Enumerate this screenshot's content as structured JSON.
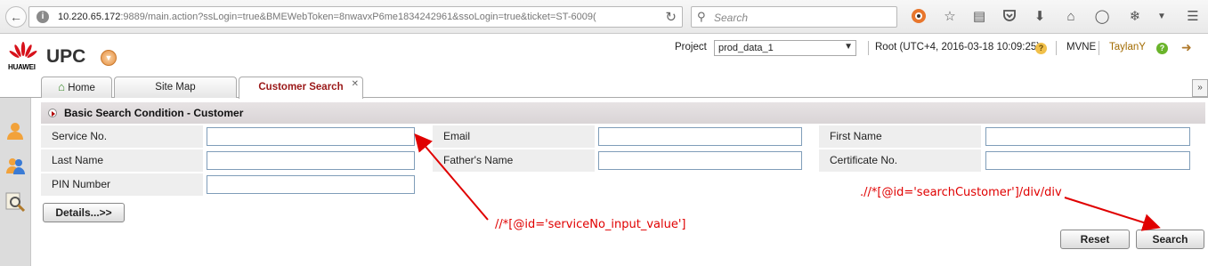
{
  "browser": {
    "url_host": "10.220.65.172",
    "url_rest": ":9889/main.action?ssLogin=true&BMEWebToken=8nwavxP6me1834242961&ssoLogin=true&ticket=ST-6009(",
    "search_placeholder": "Search",
    "icons": [
      "back-icon",
      "info-icon",
      "reload-icon",
      "search-icon",
      "extension-icon",
      "star-icon",
      "reading-list-icon",
      "pocket-icon",
      "download-icon",
      "home-icon",
      "chat-icon",
      "addon-icon",
      "menu-icon"
    ]
  },
  "header": {
    "app_title": "UPC",
    "logo_text": "HUAWEI",
    "project_label": "Project",
    "project_value": "prod_data_1",
    "root_info": "Root (UTC+4, 2016-03-18 10:09:25)",
    "tenant": "MVNE",
    "user": "TaylanY"
  },
  "tabs": [
    {
      "label": "Home"
    },
    {
      "label": "Site Map"
    },
    {
      "label": "Customer Search",
      "active": true
    }
  ],
  "section": {
    "title": "Basic Search Condition - Customer"
  },
  "form": {
    "service_no_label": "Service No.",
    "email_label": "Email",
    "first_name_label": "First Name",
    "last_name_label": "Last Name",
    "fathers_name_label": "Father's Name",
    "certificate_no_label": "Certificate No.",
    "pin_number_label": "PIN Number",
    "details_button": "Details...>>",
    "reset_button": "Reset",
    "search_button": "Search"
  },
  "annotations": {
    "service_input_xpath": "//*[@id='serviceNo_input_value']",
    "search_button_xpath": ".//*[@id='searchCustomer']/div/div"
  },
  "colors": {
    "annotation": "#e00000",
    "active_tab_text": "#9a1818",
    "user_text": "#a26b00"
  }
}
